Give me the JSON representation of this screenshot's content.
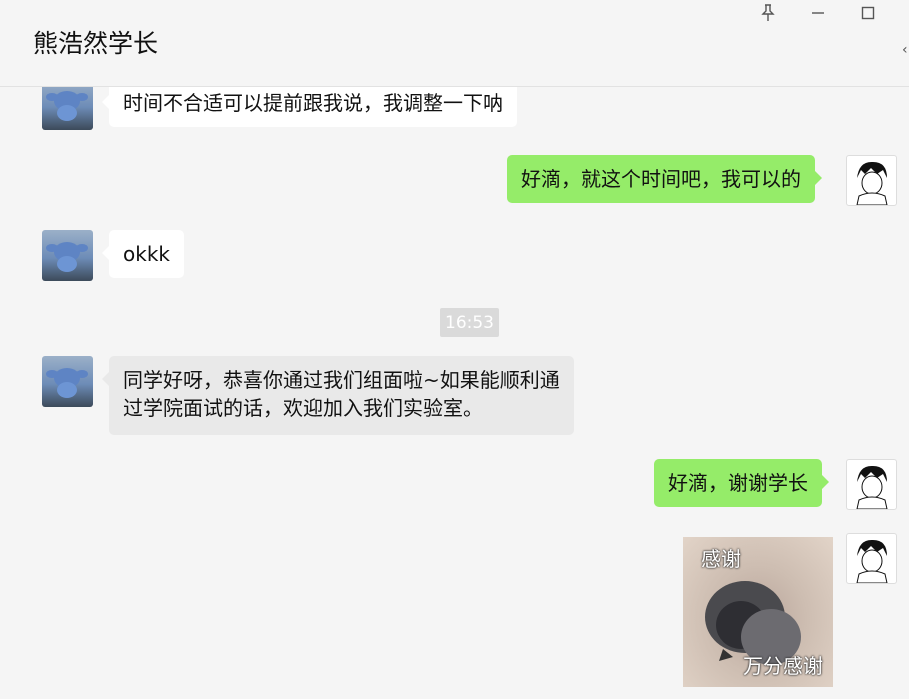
{
  "window": {
    "title": "熊浩然学长",
    "pin_icon": "pin-icon",
    "minimize_icon": "minimize-icon",
    "maximize_icon": "maximize-icon"
  },
  "messages": [
    {
      "side": "left",
      "text": "时间不合适可以提前跟我说，我调整一下呐"
    },
    {
      "side": "right",
      "text": "好滴，就这个时间吧，我可以的"
    },
    {
      "side": "left",
      "text": "okkk"
    },
    {
      "side": "left",
      "text_line1": "同学好呀，恭喜你通过我们组面啦~如果能顺利通",
      "text_line2": "过学院面试的话，欢迎加入我们实验室。"
    },
    {
      "side": "right",
      "text": "好滴，谢谢学长"
    },
    {
      "side": "right",
      "type": "sticker",
      "caption_top": "感谢",
      "caption_bottom": "万分感谢"
    }
  ],
  "timestamp": "16:53",
  "colors": {
    "background": "#f5f5f5",
    "sent_bubble": "#95ec69",
    "received_bubble": "#ffffff",
    "timestamp_bg": "#dadada"
  }
}
